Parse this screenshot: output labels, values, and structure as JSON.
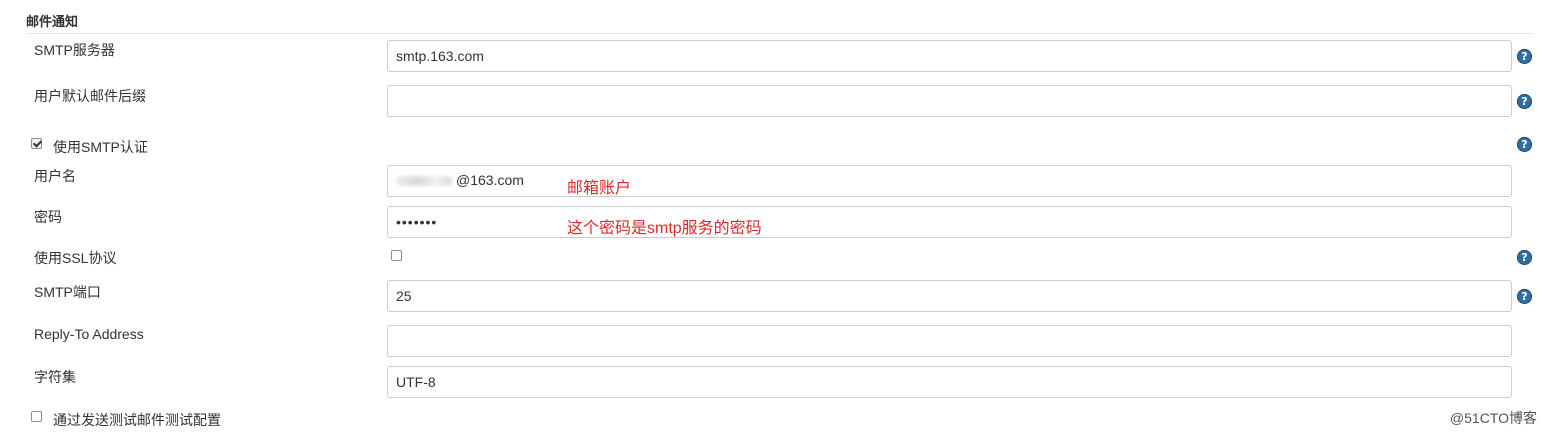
{
  "section": {
    "title": "邮件通知"
  },
  "fields": {
    "smtp_server": {
      "label": "SMTP服务器",
      "value": "smtp.163.com"
    },
    "default_suffix": {
      "label": "用户默认邮件后缀",
      "value": ""
    },
    "use_smtp_auth": {
      "label": "使用SMTP认证",
      "checked": true
    },
    "username": {
      "label": "用户名",
      "value_visible": "@163.com"
    },
    "password": {
      "label": "密码",
      "value": "•••••••"
    },
    "use_ssl": {
      "label": "使用SSL协议",
      "checked": false
    },
    "smtp_port": {
      "label": "SMTP端口",
      "value": "25"
    },
    "reply_to": {
      "label": "Reply-To Address",
      "value": ""
    },
    "charset": {
      "label": "字符集",
      "value": "UTF-8"
    },
    "test_config": {
      "label": "通过发送测试邮件测试配置",
      "checked": false
    }
  },
  "annotations": {
    "username_note": "邮箱账户",
    "password_note": "这个密码是smtp服务的密码"
  },
  "help_icon": {
    "glyph": "?",
    "color": "#2f6ea5"
  },
  "watermark": "@51CTO博客"
}
